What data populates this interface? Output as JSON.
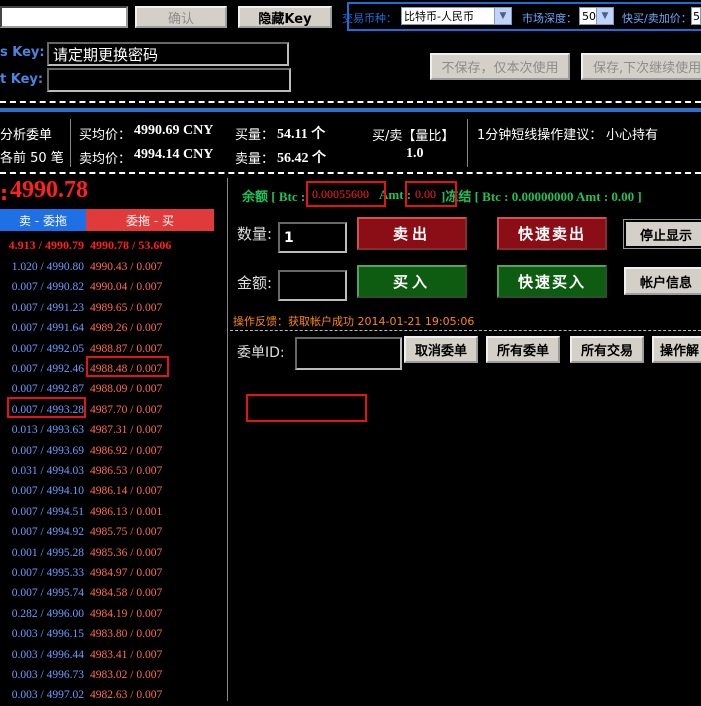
{
  "toolbar": {
    "confirm_label": "确认",
    "hide_key_label": "隐藏Key",
    "coin_label": "交易币种：",
    "coin_value": "比特币-人民币",
    "depth_label": "市场深度：",
    "depth_value": "50",
    "quick_label": "快买/卖加价：",
    "quick_value": "5"
  },
  "keys": {
    "secret_label": "s Key:",
    "secret_value": "请定期更换密码",
    "access_label": "t Key:",
    "access_value": "",
    "no_save_label": "不保存，仅本次使用",
    "save_label": "保存,下次继续使用"
  },
  "summary": {
    "analysis_label": "分析委单",
    "depth_caption": "各前 50 笔",
    "buy_avg_label": "买均价：",
    "buy_avg": "4990.69 CNY",
    "buy_vol_label": "买量：",
    "buy_vol": "54.11 个",
    "sell_avg_label": "卖均价：",
    "sell_avg": "4994.14 CNY",
    "sell_vol_label": "卖量：",
    "sell_vol": "56.42 个",
    "ratio_label": "买/卖【量比】",
    "ratio_value": "1.0",
    "advice_label": "1分钟短线操作建议：",
    "advice_value": "小心持有"
  },
  "orderbook": {
    "price_prefix": ":",
    "last_price": "4990.78",
    "tab_sell": "卖 - 委拖",
    "tab_buy": "委拖 - 买",
    "head_bid": "4.913 / 4990.79",
    "head_ask": "4990.78 / 53.606",
    "rows": [
      {
        "bid": "1.020 / 4990.80",
        "ask": "4990.43 / 0.007"
      },
      {
        "bid": "0.007 / 4990.82",
        "ask": "4990.04 / 0.007"
      },
      {
        "bid": "0.007 / 4991.23",
        "ask": "4989.65 / 0.007"
      },
      {
        "bid": "0.007 / 4991.64",
        "ask": "4989.26 / 0.007"
      },
      {
        "bid": "0.007 / 4992.05",
        "ask": "4988.87 / 0.007"
      },
      {
        "bid": "0.007 / 4992.46",
        "ask": "4988.48 / 0.007"
      },
      {
        "bid": "0.007 / 4992.87",
        "ask": "4988.09 / 0.007"
      },
      {
        "bid": "0.007 / 4993.28",
        "ask": "4987.70 / 0.007"
      },
      {
        "bid": "0.013 / 4993.63",
        "ask": "4987.31 / 0.007"
      },
      {
        "bid": "0.007 / 4993.69",
        "ask": "4986.92 / 0.007"
      },
      {
        "bid": "0.031 / 4994.03",
        "ask": "4986.53 / 0.007"
      },
      {
        "bid": "0.007 / 4994.10",
        "ask": "4986.14 / 0.007"
      },
      {
        "bid": "0.007 / 4994.51",
        "ask": "4986.13 / 0.001"
      },
      {
        "bid": "0.007 / 4994.92",
        "ask": "4985.75 / 0.007"
      },
      {
        "bid": "0.001 / 4995.28",
        "ask": "4985.36 / 0.007"
      },
      {
        "bid": "0.007 / 4995.33",
        "ask": "4984.97 / 0.007"
      },
      {
        "bid": "0.007 / 4995.74",
        "ask": "4984.58 / 0.007"
      },
      {
        "bid": "0.282 / 4996.00",
        "ask": "4984.19 / 0.007"
      },
      {
        "bid": "0.003 / 4996.15",
        "ask": "4983.80 / 0.007"
      },
      {
        "bid": "0.003 / 4996.44",
        "ask": "4983.41 / 0.007"
      },
      {
        "bid": "0.003 / 4996.73",
        "ask": "4983.02 / 0.007"
      },
      {
        "bid": "0.003 / 4997.02",
        "ask": "4982.63 / 0.007"
      }
    ]
  },
  "balance": {
    "label": "余额 [ Btc :",
    "btc": "0.00055600",
    "amt_label": "Amt :",
    "amt": "0.00",
    "frozen_label": "]冻结 [ Btc : 0.00000000 Amt : 0.00 ]"
  },
  "trade": {
    "qty_label": "数量:",
    "qty_value": "1",
    "amount_label": "金额:",
    "amount_value": "",
    "sell_label": "卖出",
    "quick_sell_label": "快速卖出",
    "stop_label": "停止显示",
    "buy_label": "买入",
    "quick_buy_label": "快速买入",
    "account_label": "帐户信息",
    "feedback": "操作反馈：获取帐户成功 2014-01-21 19:05:06",
    "order_id_label": "委单ID:",
    "order_id_value": "",
    "cancel_label": "取消委单",
    "all_orders_label": "所有委单",
    "all_trades_label": "所有交易",
    "ops_label": "操作解"
  }
}
